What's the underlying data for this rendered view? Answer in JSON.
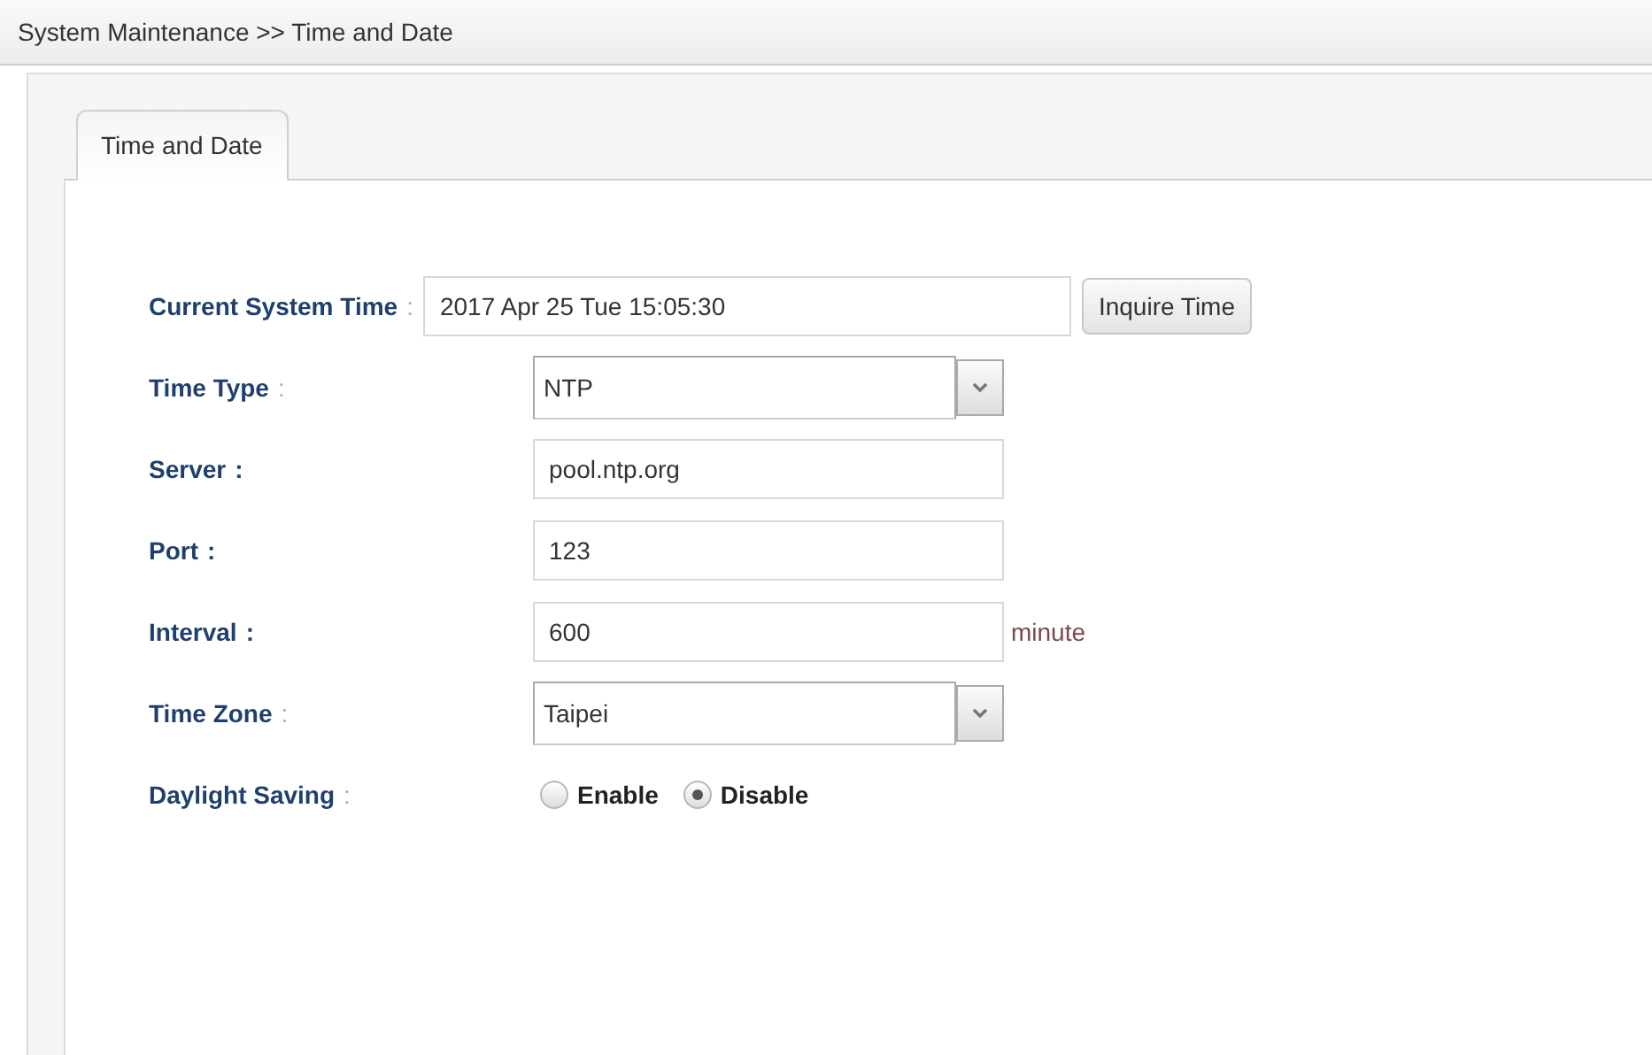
{
  "breadcrumb": "System Maintenance >> Time and Date",
  "tabs": [
    {
      "label": "Time and Date",
      "selected": true
    }
  ],
  "rows": [
    {
      "kind": "text",
      "label": "Current System Time",
      "colon": ":",
      "colon_faint": true,
      "value": "2017 Apr 25 Tue 15:05:30",
      "wide": true,
      "button": "Inquire Time"
    },
    {
      "kind": "select",
      "label": "Time Type",
      "colon": ":",
      "colon_faint": true,
      "value": "NTP"
    },
    {
      "kind": "text",
      "label": "Server",
      "colon": ":",
      "colon_faint": false,
      "value": "pool.ntp.org"
    },
    {
      "kind": "text",
      "label": "Port",
      "colon": ":",
      "colon_faint": false,
      "value": "123"
    },
    {
      "kind": "text",
      "label": "Interval",
      "colon": ":",
      "colon_faint": false,
      "value": "600",
      "unit": "minute"
    },
    {
      "kind": "select",
      "label": "Time Zone",
      "colon": ":",
      "colon_faint": true,
      "value": "Taipei"
    },
    {
      "kind": "radio",
      "label": "Daylight Saving",
      "colon": ":",
      "colon_faint": true,
      "options": [
        {
          "label": "Enable",
          "selected": false
        },
        {
          "label": "Disable",
          "selected": true
        }
      ]
    }
  ]
}
